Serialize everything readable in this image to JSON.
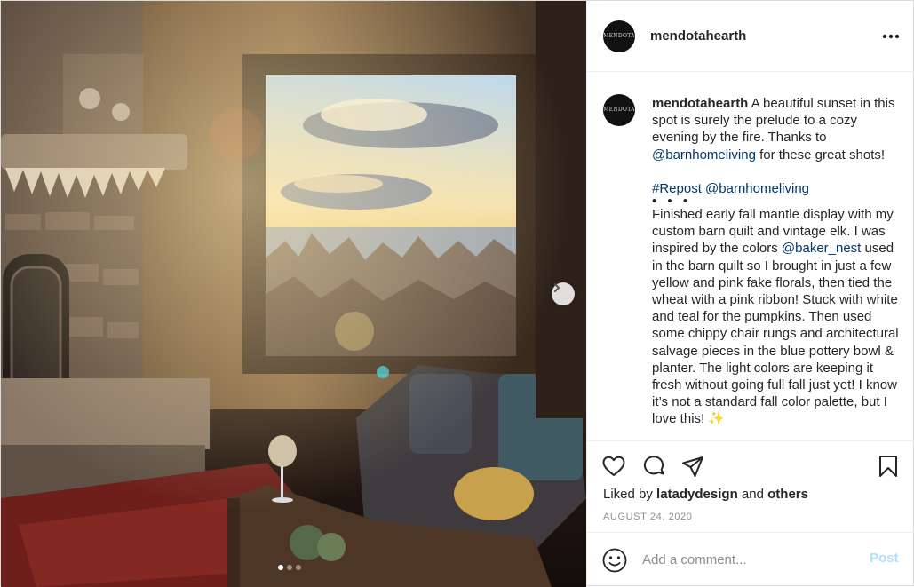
{
  "account": {
    "username": "mendotahearth",
    "avatar_text": "MENDOTA"
  },
  "caption": {
    "username": "mendotahearth",
    "intro": " A beautiful sunset in this spot is surely the prelude to a cozy evening by the fire. Thanks to ",
    "mention1": "@barnhomeliving",
    "intro_end": " for these great shots!",
    "hashtag": "#Repost",
    "repost_space": " ",
    "mention2": "@barnhomeliving",
    "dots": "• • •",
    "body_start": "Finished early fall mantle display with my custom barn quilt and vintage elk. I was inspired by the colors ",
    "mention3": "@baker_nest",
    "body_end": " used in the barn quilt so I brought in just a few yellow and pink fake florals, then tied the wheat with a pink ribbon! Stuck with white and teal for the pumpkins. Then used some chippy chair rungs and architectural salvage pieces in the blue pottery bowl & planter. The light colors are keeping it fresh without going full fall just yet! I know it’s not a standard fall color palette, but I love this! ✨"
  },
  "likes": {
    "prefix": "Liked by ",
    "user": "latadydesign",
    "middle": " and ",
    "others": "others"
  },
  "date": "AUGUST 24, 2020",
  "comment_box": {
    "placeholder": "Add a comment...",
    "post_label": "Post"
  },
  "carousel": {
    "slide_count": 3,
    "active_index": 0
  },
  "icons": {
    "more": "more-options-icon",
    "like": "heart-icon",
    "comment": "comment-icon",
    "share": "share-icon",
    "save": "bookmark-icon",
    "emoji": "emoji-icon",
    "next": "chevron-right-icon"
  },
  "colors": {
    "link": "#00376b",
    "post_button_disabled": "#b2dffc",
    "muted": "#8e8e8e",
    "border": "#dbdbdb"
  }
}
